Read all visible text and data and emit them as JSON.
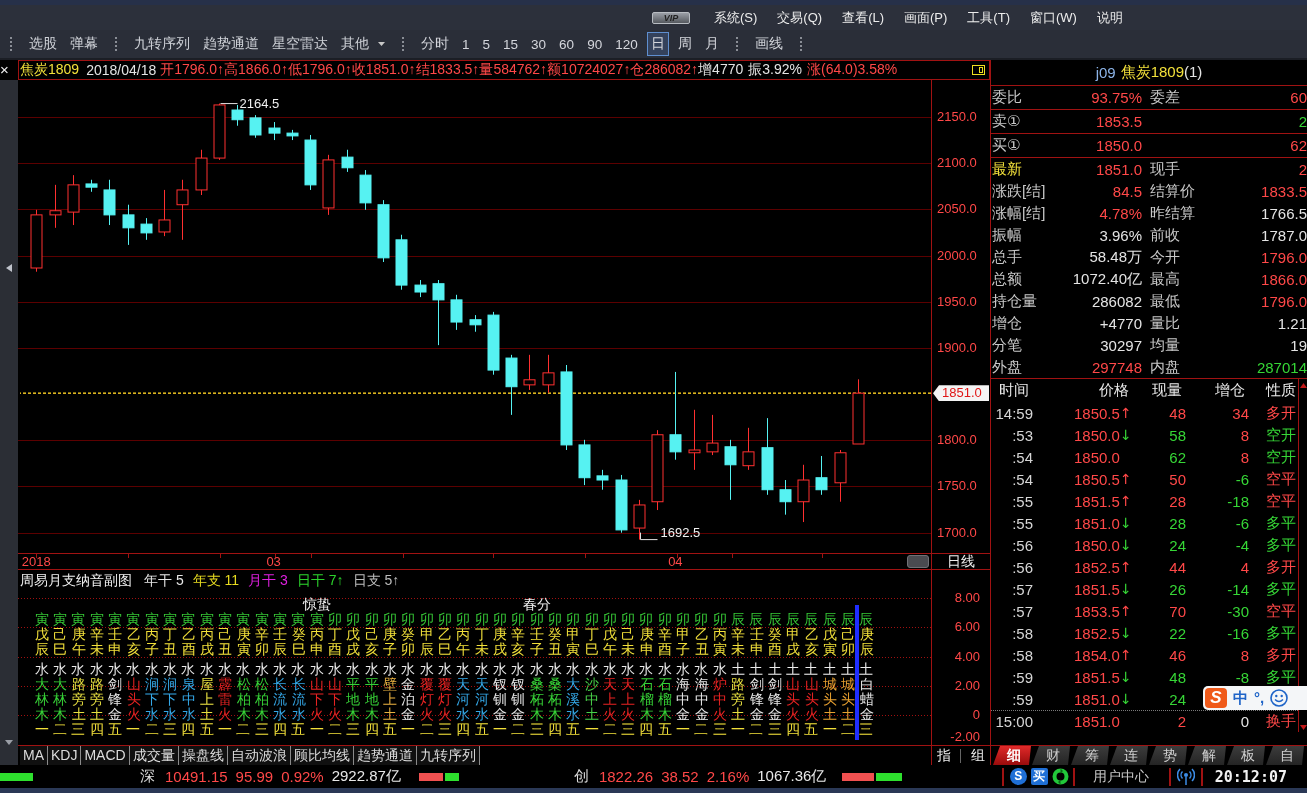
{
  "menu_bar": {
    "badge": "VIP",
    "items": [
      "系统(S)",
      "交易(Q)",
      "查看(L)",
      "画面(P)",
      "工具(T)",
      "窗口(W)",
      "说明"
    ]
  },
  "toolbar": {
    "tools": [
      "选股",
      "弹幕"
    ],
    "indicators": [
      {
        "label": "九转序列",
        "kind": "button"
      },
      {
        "label": "趋势通道",
        "kind": "button"
      },
      {
        "label": "星空雷达",
        "kind": "button"
      },
      {
        "label": "其他",
        "kind": "dropdown"
      }
    ],
    "periods": [
      {
        "label": "分时",
        "selected": false
      },
      {
        "label": "1",
        "selected": false
      },
      {
        "label": "5",
        "selected": false
      },
      {
        "label": "15",
        "selected": false
      },
      {
        "label": "30",
        "selected": false
      },
      {
        "label": "60",
        "selected": false
      },
      {
        "label": "90",
        "selected": false
      },
      {
        "label": "120",
        "selected": false
      },
      {
        "label": "日",
        "selected": true
      },
      {
        "label": "周",
        "selected": false
      },
      {
        "label": "月",
        "selected": false
      }
    ],
    "drawing": "画线"
  },
  "chart": {
    "close": "×",
    "header": {
      "symbol": "焦炭1809",
      "date": "2018/04/18",
      "fields": [
        {
          "text": "开1796.0↑",
          "rising": true
        },
        {
          "text": "高1866.0↑",
          "rising": true
        },
        {
          "text": "低1796.0↑",
          "rising": true
        },
        {
          "text": "收1851.0↑",
          "rising": true
        },
        {
          "text": "结1833.5↑",
          "rising": true
        },
        {
          "text": "量584762↑",
          "rising": true
        },
        {
          "text": "额10724027↑",
          "rising": true
        },
        {
          "text": "仓286082↑",
          "rising": true
        },
        {
          "text": "增4770",
          "rising": false
        },
        {
          "text": "振3.92%",
          "rising": false
        },
        {
          "text": "涨(64.0)3.58%",
          "rising": true
        }
      ]
    },
    "chart_data": {
      "type": "candlestick",
      "categories": [
        "2018",
        null,
        null,
        null,
        null,
        null,
        null,
        null,
        null,
        null,
        null,
        null,
        null,
        "03",
        null,
        null,
        null,
        null,
        null,
        null,
        null,
        null,
        null,
        null,
        null,
        null,
        null,
        null,
        null,
        null,
        null,
        null,
        null,
        null,
        null,
        "04",
        null,
        null,
        null,
        null,
        null,
        null,
        null,
        null,
        null,
        null
      ],
      "ohlc": [
        [
          1986.5,
          2049.5,
          1982.5,
          2044
        ],
        [
          2044,
          2076.5,
          2030,
          2048.5
        ],
        [
          2047,
          2087,
          2033,
          2076.5
        ],
        [
          2077.5,
          2082,
          2069,
          2074
        ],
        [
          2071,
          2082,
          2033,
          2044
        ],
        [
          2044,
          2055,
          2011.5,
          2030
        ],
        [
          2034,
          2040.5,
          2017,
          2024.5
        ],
        [
          2025.5,
          2071,
          2021,
          2038.5
        ],
        [
          2055,
          2082,
          2017,
          2071
        ],
        [
          2071,
          2114.5,
          2065.5,
          2105.5
        ],
        [
          2105.5,
          2164.5,
          2103.5,
          2163
        ],
        [
          2157.5,
          2163,
          2140.5,
          2147
        ],
        [
          2149,
          2152,
          2127.5,
          2130.5
        ],
        [
          2138,
          2144.5,
          2125,
          2132.5
        ],
        [
          2132.5,
          2136,
          2125,
          2129.5
        ],
        [
          2125,
          2130.5,
          2071,
          2076.5
        ],
        [
          2051.5,
          2109,
          2044,
          2103.5
        ],
        [
          2106.5,
          2114.5,
          2090.5,
          2095
        ],
        [
          2087,
          2092.5,
          2049.5,
          2057
        ],
        [
          2055,
          2060,
          1993,
          1997.5
        ],
        [
          2017,
          2022.5,
          1963,
          1968
        ],
        [
          1968,
          1973.5,
          1955,
          1960.5
        ],
        [
          1969.5,
          1973.5,
          1903,
          1952
        ],
        [
          1952,
          1957.5,
          1919.5,
          1928
        ],
        [
          1930.5,
          1935.5,
          1917.5,
          1925
        ],
        [
          1935.5,
          1939,
          1871,
          1876
        ],
        [
          1889,
          1892.5,
          1827.5,
          1858
        ],
        [
          1860,
          1892.5,
          1854.5,
          1865.5
        ],
        [
          1860,
          1892.5,
          1851.5,
          1873
        ],
        [
          1874,
          1881.5,
          1789.5,
          1795
        ],
        [
          1795,
          1800.5,
          1751.5,
          1759.5
        ],
        [
          1761.5,
          1768,
          1746.5,
          1757
        ],
        [
          1757,
          1762.5,
          1700,
          1703
        ],
        [
          1705,
          1735.5,
          1692.5,
          1730
        ],
        [
          1733.5,
          1811,
          1724.5,
          1806
        ],
        [
          1806,
          1874,
          1779,
          1787.5
        ],
        [
          1786.5,
          1833,
          1768,
          1789.5
        ],
        [
          1787.5,
          1827.5,
          1784,
          1797
        ],
        [
          1793,
          1800.5,
          1735.5,
          1773.5
        ],
        [
          1772.5,
          1813.5,
          1768,
          1787.5
        ],
        [
          1792,
          1824,
          1741,
          1746.5
        ],
        [
          1746.5,
          1757,
          1719.5,
          1733.5
        ],
        [
          1733.5,
          1773.5,
          1711.5,
          1757
        ],
        [
          1759.5,
          1783,
          1741,
          1746.5
        ],
        [
          1754,
          1789.5,
          1733.5,
          1786.5
        ],
        [
          1796,
          1866,
          1796,
          1851
        ]
      ],
      "ylim": [
        1678,
        2190
      ],
      "yticks": [
        {
          "value": 2150,
          "label": "2150.0"
        },
        {
          "value": 2100,
          "label": "2100.0"
        },
        {
          "value": 2050,
          "label": "2050.0"
        },
        {
          "value": 2000,
          "label": "2000.0"
        },
        {
          "value": 1950,
          "label": "1950.0"
        },
        {
          "value": 1900,
          "label": "1900.0"
        },
        {
          "value": 1800,
          "label": "1800.0"
        },
        {
          "value": 1750,
          "label": "1750.0"
        },
        {
          "value": 1700,
          "label": "1700.0"
        }
      ],
      "grid": true,
      "annotations": [
        "2164.5",
        "1692.5"
      ],
      "ref_lines": [
        {
          "axis": "y",
          "value": 1851
        }
      ]
    },
    "current_price": "1851.0",
    "period_label": "日线"
  },
  "subchart": {
    "title": "周易月支纳音副图",
    "params": [
      {
        "label": "年干",
        "value": "5",
        "color": "#e6e6e6"
      },
      {
        "label": "年支",
        "value": "11",
        "color": "#e8dc20"
      },
      {
        "label": "月干",
        "value": "3",
        "color": "#e020e0"
      },
      {
        "label": "日干",
        "value": "7↑",
        "color": "#2cd42c"
      },
      {
        "label": "日支",
        "value": "5↑",
        "color": "#bdbdbd"
      }
    ],
    "axis": [
      "8.00",
      "6.00",
      "4.00",
      "2.00",
      "0",
      "-2.00"
    ],
    "columns": [
      {
        "month": "寅",
        "day": "戊辰",
        "season": "水",
        "nayin": "大林木",
        "color": "#36d036",
        "weekday": "一",
        "selected": false
      },
      {
        "month": "寅",
        "day": "己巳",
        "season": "水",
        "nayin": "大林木",
        "color": "#36d036",
        "weekday": "二",
        "selected": false
      },
      {
        "month": "寅",
        "day": "庚午",
        "season": "水",
        "nayin": "路旁土",
        "color": "#e8e040",
        "weekday": "三",
        "selected": false
      },
      {
        "month": "寅",
        "day": "辛未",
        "season": "水",
        "nayin": "路旁土",
        "color": "#e8e040",
        "weekday": "四",
        "selected": false
      },
      {
        "month": "寅",
        "day": "壬申",
        "season": "水",
        "nayin": "剑锋金",
        "color": "#e8e8e8",
        "weekday": "五",
        "selected": false
      },
      {
        "month": "寅",
        "day": "乙亥",
        "season": "水",
        "nayin": "山头火",
        "color": "#e82222",
        "weekday": "一",
        "selected": false
      },
      {
        "month": "寅",
        "day": "丙子",
        "season": "水",
        "nayin": "涧下水",
        "color": "#34a8e8",
        "weekday": "二",
        "selected": false
      },
      {
        "month": "寅",
        "day": "丁丑",
        "season": "水",
        "nayin": "涧下水",
        "color": "#34a8e8",
        "weekday": "三",
        "selected": false
      },
      {
        "month": "寅",
        "day": "乙酉",
        "season": "水",
        "nayin": "泉中水",
        "color": "#34a8e8",
        "weekday": "四",
        "selected": false
      },
      {
        "month": "寅",
        "day": "丙戌",
        "season": "水",
        "nayin": "屋上土",
        "color": "#e8e040",
        "weekday": "五",
        "selected": false
      },
      {
        "month": "寅",
        "day": "己丑",
        "season": "水",
        "nayin": "霹雷火",
        "color": "#e82222",
        "weekday": "一",
        "selected": false
      },
      {
        "month": "寅",
        "day": "庚寅",
        "season": "水",
        "nayin": "松柏木",
        "color": "#36d036",
        "weekday": "二",
        "selected": false
      },
      {
        "month": "寅",
        "day": "辛卯",
        "season": "水",
        "nayin": "松柏木",
        "color": "#36d036",
        "weekday": "三",
        "selected": false
      },
      {
        "month": "寅",
        "day": "壬辰",
        "season": "水",
        "nayin": "长流水",
        "color": "#34a8e8",
        "weekday": "四",
        "selected": false
      },
      {
        "month": "寅",
        "day": "癸巳",
        "season": "水",
        "nayin": "长流水",
        "color": "#34a8e8",
        "weekday": "五",
        "selected": false
      },
      {
        "month": "寅",
        "day": "丙申",
        "season": "水",
        "nayin": "山下火",
        "color": "#e82222",
        "weekday": "一",
        "term": "惊蛰",
        "selected": false
      },
      {
        "month": "卯",
        "day": "丁酉",
        "season": "水",
        "nayin": "山下火",
        "color": "#e82222",
        "weekday": "二",
        "selected": false
      },
      {
        "month": "卯",
        "day": "戊戌",
        "season": "水",
        "nayin": "平地木",
        "color": "#36d036",
        "weekday": "三",
        "selected": false
      },
      {
        "month": "卯",
        "day": "己亥",
        "season": "水",
        "nayin": "平地木",
        "color": "#36d036",
        "weekday": "四",
        "selected": false
      },
      {
        "month": "卯",
        "day": "庚子",
        "season": "水",
        "nayin": "壁上土",
        "color": "#e8b040",
        "weekday": "五",
        "selected": false
      },
      {
        "month": "卯",
        "day": "癸卯",
        "season": "水",
        "nayin": "金泊金",
        "color": "#e8e8e8",
        "weekday": "一",
        "selected": false
      },
      {
        "month": "卯",
        "day": "甲辰",
        "season": "水",
        "nayin": "覆灯火",
        "color": "#e82222",
        "weekday": "二",
        "selected": false
      },
      {
        "month": "卯",
        "day": "乙巳",
        "season": "水",
        "nayin": "覆灯火",
        "color": "#e82222",
        "weekday": "三",
        "selected": false
      },
      {
        "month": "卯",
        "day": "丙午",
        "season": "水",
        "nayin": "天河水",
        "color": "#34a8e8",
        "weekday": "四",
        "selected": false
      },
      {
        "month": "卯",
        "day": "丁未",
        "season": "水",
        "nayin": "天河水",
        "color": "#34a8e8",
        "weekday": "五",
        "selected": false
      },
      {
        "month": "卯",
        "day": "庚戌",
        "season": "水",
        "nayin": "钗钏金",
        "color": "#e8e8e8",
        "weekday": "一",
        "selected": false
      },
      {
        "month": "卯",
        "day": "辛亥",
        "season": "水",
        "nayin": "钗钏金",
        "color": "#e8e8e8",
        "weekday": "二",
        "selected": false
      },
      {
        "month": "卯",
        "day": "壬子",
        "season": "水",
        "nayin": "桑柘木",
        "color": "#36d036",
        "weekday": "三",
        "term": "春分",
        "selected": false
      },
      {
        "month": "卯",
        "day": "癸丑",
        "season": "水",
        "nayin": "桑柘木",
        "color": "#36d036",
        "weekday": "四",
        "selected": false
      },
      {
        "month": "卯",
        "day": "甲寅",
        "season": "水",
        "nayin": "大溪水",
        "color": "#34a8e8",
        "weekday": "五",
        "selected": false
      },
      {
        "month": "卯",
        "day": "丁巳",
        "season": "水",
        "nayin": "沙中土",
        "color": "#48d048",
        "weekday": "一",
        "selected": false
      },
      {
        "month": "卯",
        "day": "戊午",
        "season": "水",
        "nayin": "天上火",
        "color": "#e82222",
        "weekday": "二",
        "selected": false
      },
      {
        "month": "卯",
        "day": "己未",
        "season": "水",
        "nayin": "天上火",
        "color": "#e82222",
        "weekday": "三",
        "selected": false
      },
      {
        "month": "卯",
        "day": "庚申",
        "season": "水",
        "nayin": "石榴木",
        "color": "#36d036",
        "weekday": "四",
        "selected": false
      },
      {
        "month": "卯",
        "day": "辛酉",
        "season": "水",
        "nayin": "石榴木",
        "color": "#36d036",
        "weekday": "五",
        "selected": false
      },
      {
        "month": "卯",
        "day": "甲子",
        "season": "水",
        "nayin": "海中金",
        "color": "#e8e8e8",
        "weekday": "一",
        "selected": false
      },
      {
        "month": "卯",
        "day": "乙丑",
        "season": "水",
        "nayin": "海中金",
        "color": "#e8e8e8",
        "weekday": "二",
        "selected": false
      },
      {
        "month": "卯",
        "day": "丙寅",
        "season": "水",
        "nayin": "炉中火",
        "color": "#e82222",
        "weekday": "三",
        "selected": false
      },
      {
        "month": "辰",
        "day": "辛未",
        "season": "土",
        "nayin": "路旁土",
        "color": "#e8e040",
        "weekday": "一",
        "selected": false
      },
      {
        "month": "辰",
        "day": "壬申",
        "season": "土",
        "nayin": "剑锋金",
        "color": "#e8e8e8",
        "weekday": "二",
        "selected": false
      },
      {
        "month": "辰",
        "day": "癸酉",
        "season": "土",
        "nayin": "剑锋金",
        "color": "#e8e8e8",
        "weekday": "三",
        "selected": false
      },
      {
        "month": "辰",
        "day": "甲戌",
        "season": "土",
        "nayin": "山头火",
        "color": "#e82222",
        "weekday": "四",
        "selected": false
      },
      {
        "month": "辰",
        "day": "乙亥",
        "season": "土",
        "nayin": "山头火",
        "color": "#e82222",
        "weekday": "五",
        "selected": false
      },
      {
        "month": "辰",
        "day": "戊寅",
        "season": "土",
        "nayin": "城头土",
        "color": "#e8a030",
        "weekday": "一",
        "selected": false
      },
      {
        "month": "辰",
        "day": "己卯",
        "season": "土",
        "nayin": "城头土",
        "color": "#e8a030",
        "weekday": "二",
        "selected": false
      },
      {
        "month": "辰",
        "day": "庚辰",
        "season": "土",
        "nayin": "白蜡金",
        "color": "#e8e8e8",
        "weekday": "三",
        "selected": true
      }
    ]
  },
  "indicator_tabs": [
    "MA",
    "KDJ",
    "MACD",
    "成交量",
    "操盘线",
    "自动波浪",
    "顾比均线",
    "趋势通道",
    "九转序列"
  ],
  "side_buttons": [
    "指",
    "组"
  ],
  "quote": {
    "title": {
      "code": "j09",
      "name": "焦炭1809",
      "suffix": "(1)"
    },
    "book": [
      {
        "left": {
          "label": "委比",
          "value": "93.75%",
          "color": "#ff4848"
        },
        "right": {
          "label": "委差",
          "value": "60",
          "color": "#ff4848"
        }
      },
      {
        "left": {
          "label": "卖①",
          "value": "1853.5",
          "color": "#ff4848"
        },
        "right": {
          "value": "2",
          "color": "#36d636"
        }
      },
      {
        "left": {
          "label": "买①",
          "value": "1850.0",
          "color": "#ff4848"
        },
        "right": {
          "value": "62",
          "color": "#ff4848"
        }
      }
    ],
    "stats": [
      {
        "left": {
          "label": "最新",
          "value": "1851.0",
          "color": "#ff4848",
          "highlight": true
        },
        "right": {
          "label": "现手",
          "value": "2",
          "color": "#ff4848"
        }
      },
      {
        "left": {
          "label": "涨跌[结]",
          "value": "84.5",
          "color": "#ff4848",
          "highlight": false
        },
        "right": {
          "label": "结算价",
          "value": "1833.5",
          "color": "#ff4848"
        }
      },
      {
        "left": {
          "label": "涨幅[结]",
          "value": "4.78%",
          "color": "#ff4848",
          "highlight": false
        },
        "right": {
          "label": "昨结算",
          "value": "1766.5",
          "color": "#e4e4e4"
        }
      },
      {
        "left": {
          "label": "振幅",
          "value": "3.96%",
          "color": "#e4e4e4",
          "highlight": false
        },
        "right": {
          "label": "前收",
          "value": "1787.0",
          "color": "#e4e4e4"
        }
      },
      {
        "left": {
          "label": "总手",
          "value": "58.48万",
          "color": "#e4e4e4",
          "highlight": false
        },
        "right": {
          "label": "今开",
          "value": "1796.0",
          "color": "#ff4848"
        }
      },
      {
        "left": {
          "label": "总额",
          "value": "1072.40亿",
          "color": "#e4e4e4",
          "highlight": false
        },
        "right": {
          "label": "最高",
          "value": "1866.0",
          "color": "#ff4848"
        }
      },
      {
        "left": {
          "label": "持仓量",
          "value": "286082",
          "color": "#e4e4e4",
          "highlight": false
        },
        "right": {
          "label": "最低",
          "value": "1796.0",
          "color": "#ff4848"
        }
      },
      {
        "left": {
          "label": "增仓",
          "value": "+4770",
          "color": "#e4e4e4",
          "highlight": false
        },
        "right": {
          "label": "量比",
          "value": "1.21",
          "color": "#e4e4e4"
        }
      },
      {
        "left": {
          "label": "分笔",
          "value": "30297",
          "color": "#e4e4e4",
          "highlight": false
        },
        "right": {
          "label": "均量",
          "value": "19",
          "color": "#e4e4e4"
        }
      },
      {
        "left": {
          "label": "外盘",
          "value": "297748",
          "color": "#ff4848",
          "highlight": false
        },
        "right": {
          "label": "内盘",
          "value": "287014",
          "color": "#36d636"
        }
      }
    ]
  },
  "trades": {
    "columns": [
      "时间",
      "价格",
      "现量",
      "增仓",
      "性质"
    ],
    "rows": [
      {
        "time": "14:59",
        "price": "1850.5",
        "arrow": "↑",
        "volume": "48",
        "oi": {
          "text": "34",
          "color": "#ff4848"
        },
        "nature": "多开",
        "buy": true
      },
      {
        "time": ":53",
        "price": "1850.0",
        "arrow": "↓",
        "volume": "58",
        "oi": {
          "text": "8",
          "color": "#ff4848"
        },
        "nature": "空开",
        "buy": false
      },
      {
        "time": ":54",
        "price": "1850.0",
        "volume": "62",
        "oi": {
          "text": "8",
          "color": "#ff4848"
        },
        "nature": "空开",
        "buy": false
      },
      {
        "time": ":54",
        "price": "1850.5",
        "arrow": "↑",
        "volume": "50",
        "oi": {
          "text": "-6",
          "color": "#36d636"
        },
        "nature": "空平",
        "buy": true
      },
      {
        "time": ":55",
        "price": "1851.5",
        "arrow": "↑",
        "volume": "28",
        "oi": {
          "text": "-18",
          "color": "#36d636"
        },
        "nature": "空平",
        "buy": true
      },
      {
        "time": ":55",
        "price": "1851.0",
        "arrow": "↓",
        "volume": "28",
        "oi": {
          "text": "-6",
          "color": "#36d636"
        },
        "nature": "多平",
        "buy": false
      },
      {
        "time": ":56",
        "price": "1850.0",
        "arrow": "↓",
        "volume": "24",
        "oi": {
          "text": "-4",
          "color": "#36d636"
        },
        "nature": "多平",
        "buy": false
      },
      {
        "time": ":56",
        "price": "1852.5",
        "arrow": "↑",
        "volume": "44",
        "oi": {
          "text": "4",
          "color": "#ff4848"
        },
        "nature": "多开",
        "buy": true
      },
      {
        "time": ":57",
        "price": "1851.5",
        "arrow": "↓",
        "volume": "26",
        "oi": {
          "text": "-14",
          "color": "#36d636"
        },
        "nature": "多平",
        "buy": false
      },
      {
        "time": ":57",
        "price": "1853.5",
        "arrow": "↑",
        "volume": "70",
        "oi": {
          "text": "-30",
          "color": "#36d636"
        },
        "nature": "空平",
        "buy": true
      },
      {
        "time": ":58",
        "price": "1852.5",
        "arrow": "↓",
        "volume": "22",
        "oi": {
          "text": "-16",
          "color": "#36d636"
        },
        "nature": "多平",
        "buy": false
      },
      {
        "time": ":58",
        "price": "1854.0",
        "arrow": "↑",
        "volume": "46",
        "oi": {
          "text": "8",
          "color": "#ff4848"
        },
        "nature": "多开",
        "buy": true
      },
      {
        "time": ":59",
        "price": "1851.5",
        "arrow": "↓",
        "volume": "48",
        "oi": {
          "text": "-8",
          "color": "#36d636"
        },
        "nature": "多平",
        "buy": false
      },
      {
        "time": ":59",
        "price": "1851.0",
        "arrow": "↓",
        "volume": "24",
        "buy": false
      }
    ],
    "closing": {
      "time": "15:00",
      "price": "1851.0",
      "volume": "2",
      "oi": {
        "text": "0",
        "color": "#e4e4e4"
      },
      "nature": "换手",
      "buy": true
    }
  },
  "ime_bar": {
    "logo": "S",
    "mode": "中",
    "punctuation": "°,"
  },
  "panel_tabs": [
    {
      "label": "细",
      "selected": true
    },
    {
      "label": "财",
      "selected": false
    },
    {
      "label": "筹",
      "selected": false
    },
    {
      "label": "连",
      "selected": false
    },
    {
      "label": "势",
      "selected": false
    },
    {
      "label": "解",
      "selected": false
    },
    {
      "label": "板",
      "selected": false
    },
    {
      "label": "自",
      "selected": false
    }
  ],
  "status_bar": {
    "segments": [
      {
        "kind": "meter",
        "level": 0
      },
      {
        "kind": "index",
        "name": "深",
        "value": "10491.15",
        "change": "95.99",
        "percent": "0.92%",
        "amount": "2922.87亿",
        "color": "#ff4848"
      },
      {
        "kind": "meter",
        "level": 0.6
      },
      {
        "kind": "index",
        "name": "创",
        "value": "1822.26",
        "change": "38.52",
        "percent": "2.16%",
        "amount": "1067.36亿",
        "color": "#ff4848"
      },
      {
        "kind": "meter",
        "level": 0.53
      }
    ],
    "badges": [
      "S",
      "买"
    ],
    "user_center": "用户中心",
    "clock": "20:12:07"
  }
}
